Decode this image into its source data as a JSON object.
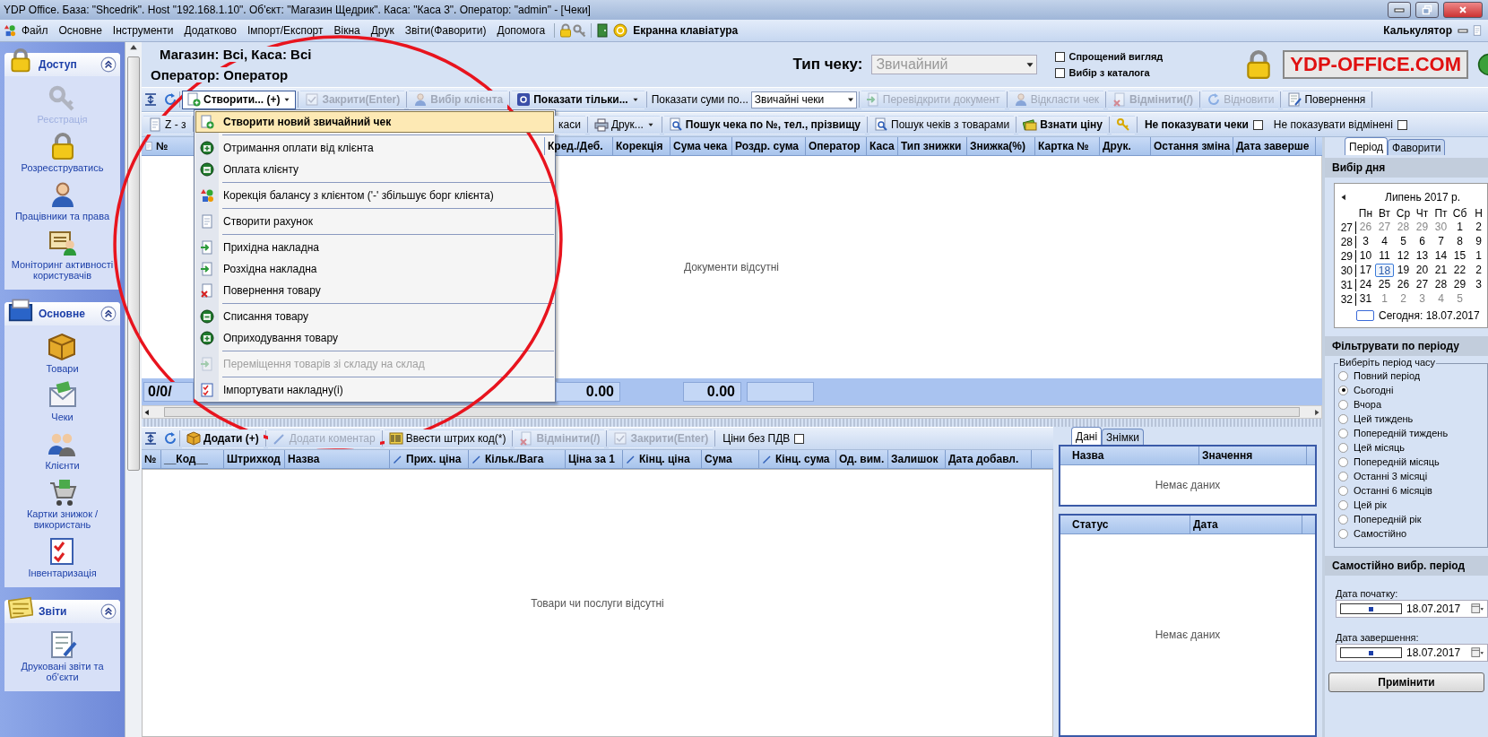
{
  "window": {
    "title": "YDP Office. База: \"Shcedrik\". Host \"192.168.1.10\". Об'єкт: \"Магазин Щедрик\". Каса: \"Каса 3\". Оператор: \"admin\" - [Чеки]"
  },
  "menu_bar": {
    "items": [
      "Файл",
      "Основне",
      "Інструменти",
      "Додатково",
      "Імпорт/Експорт",
      "Вікна",
      "Друк",
      "Звіти(Фаворити)",
      "Допомога"
    ],
    "keyboard": "Екранна клавіатура",
    "calculator": "Калькулятор"
  },
  "sidebar": {
    "groups": [
      {
        "title": "Доступ",
        "items": [
          {
            "label": "Реєстрація",
            "disabled": true
          },
          {
            "label": "Розреєструватись",
            "disabled": false
          },
          {
            "label": "Працівники та права",
            "disabled": false
          },
          {
            "label": "Моніторинг активності користувачів",
            "disabled": false
          }
        ]
      },
      {
        "title": "Основне",
        "items": [
          {
            "label": "Товари",
            "disabled": false
          },
          {
            "label": "Чеки",
            "disabled": false
          },
          {
            "label": "Клієнти",
            "disabled": false
          },
          {
            "label": "Картки знижок / використань",
            "disabled": false
          },
          {
            "label": "Інвентаризація",
            "disabled": false
          }
        ]
      },
      {
        "title": "Звіти",
        "items": [
          {
            "label": "Друковані звіти та об'єкти",
            "disabled": false
          }
        ]
      }
    ]
  },
  "header": {
    "store": "Магазин:  Всі, Каса: Всі",
    "operator": "Оператор:  Оператор",
    "check_type_label": "Тип чеку:",
    "check_type": {
      "value": "Звичайний",
      "disabled": true
    },
    "options": [
      {
        "label": "Спрощений вигляд",
        "checked": false
      },
      {
        "label": "Вибір з каталога",
        "checked": false
      }
    ],
    "logo": "YDP-OFFICE.COM"
  },
  "toolbar": {
    "items": [
      {
        "kind": "button",
        "label": "Створити... (+)",
        "bold": true,
        "disabled": false,
        "dropdown": true,
        "pressed": true
      },
      {
        "kind": "button",
        "label": "Закрити(Enter)",
        "bold": true,
        "disabled": true,
        "dropdown": false,
        "pressed": false
      },
      {
        "kind": "button",
        "label": "Вибір клієнта",
        "bold": true,
        "disabled": true,
        "dropdown": false,
        "pressed": false
      },
      {
        "kind": "button",
        "label": "Показати тільки...",
        "bold": true,
        "disabled": false,
        "dropdown": true,
        "pressed": false
      },
      {
        "kind": "label",
        "label": "Показати суми по..."
      },
      {
        "kind": "select",
        "label": "Звичайні чеки"
      },
      {
        "kind": "button",
        "label": "Перевідкрити документ",
        "bold": false,
        "disabled": true,
        "dropdown": false,
        "pressed": false
      },
      {
        "kind": "button",
        "label": "Відкласти чек",
        "bold": false,
        "disabled": true,
        "dropdown": false,
        "pressed": false
      },
      {
        "kind": "button",
        "label": "Відмінити(/)",
        "bold": true,
        "disabled": true,
        "dropdown": false,
        "pressed": false
      },
      {
        "kind": "button",
        "label": "Відновити",
        "bold": false,
        "disabled": true,
        "dropdown": false,
        "pressed": false
      },
      {
        "kind": "button",
        "label": "Повернення",
        "bold": false,
        "disabled": false,
        "dropdown": false,
        "pressed": false
      }
    ]
  },
  "toolbar2": {
    "left": [
      {
        "kind": "button",
        "label": "Z - з",
        "bold": false,
        "disabled": false,
        "dropdown": false
      }
    ],
    "right": [
      {
        "kind": "button",
        "label": "каси",
        "bold": false,
        "disabled": false,
        "dropdown": false
      },
      {
        "kind": "button",
        "label": "Друк...",
        "bold": false,
        "disabled": false,
        "dropdown": true
      },
      {
        "kind": "button",
        "label": "Пошук чека по №, тел., прізвищу",
        "bold": true,
        "disabled": false,
        "dropdown": false
      },
      {
        "kind": "button",
        "label": "Пошук чеків з товарами",
        "bold": false,
        "disabled": false,
        "dropdown": false
      },
      {
        "kind": "button",
        "label": "Взнати ціну",
        "bold": true,
        "disabled": false,
        "dropdown": false
      },
      {
        "kind": "icon"
      },
      {
        "kind": "checkbox",
        "label": "Не показувати чеки",
        "bold": true,
        "checked": false
      },
      {
        "kind": "checkbox",
        "label": "Не показувати відмінені",
        "bold": false,
        "checked": false
      }
    ]
  },
  "documents_table": {
    "first_column": "№",
    "columns": [
      "Кред./Деб.",
      "Корекція",
      "Сума чека",
      "Роздр. сума",
      "Оператор",
      "Каса",
      "Тип знижки",
      "Знижка(%)",
      "Картка №",
      "Друк.",
      "Остання зміна",
      "Дата заверше"
    ],
    "empty": "Документи відсутні",
    "totals_first": "0/0/",
    "totals": [
      "0.00",
      "0.00"
    ]
  },
  "create_menu": {
    "items": [
      {
        "kind": "item",
        "label": "Створити новий звичайний чек",
        "selected": true,
        "disabled": false
      },
      {
        "kind": "separator"
      },
      {
        "kind": "item",
        "label": "Отримання оплати від клієнта",
        "selected": false,
        "disabled": false
      },
      {
        "kind": "item",
        "label": "Оплата клієнту",
        "selected": false,
        "disabled": false
      },
      {
        "kind": "separator"
      },
      {
        "kind": "item",
        "label": "Корекція балансу з клієнтом ('-' збільшує борг клієнта)",
        "selected": false,
        "disabled": false
      },
      {
        "kind": "separator"
      },
      {
        "kind": "item",
        "label": "Створити рахунок",
        "selected": false,
        "disabled": false
      },
      {
        "kind": "separator"
      },
      {
        "kind": "item",
        "label": "Прихідна накладна",
        "selected": false,
        "disabled": false
      },
      {
        "kind": "item",
        "label": "Розхідна накладна",
        "selected": false,
        "disabled": false
      },
      {
        "kind": "item",
        "label": "Повернення товару",
        "selected": false,
        "disabled": false
      },
      {
        "kind": "separator"
      },
      {
        "kind": "item",
        "label": "Списання товару",
        "selected": false,
        "disabled": false
      },
      {
        "kind": "item",
        "label": "Оприходування товару",
        "selected": false,
        "disabled": false
      },
      {
        "kind": "separator"
      },
      {
        "kind": "item",
        "label": "Переміщення товарів зі складу на склад",
        "selected": false,
        "disabled": true
      },
      {
        "kind": "separator"
      },
      {
        "kind": "item",
        "label": "Імпортувати накладну(і)",
        "selected": false,
        "disabled": false
      }
    ]
  },
  "goods_toolbar": {
    "items": [
      {
        "kind": "button",
        "label": "Додати (+)",
        "bold": true,
        "disabled": false
      },
      {
        "kind": "button",
        "label": "Додати коментар",
        "bold": false,
        "disabled": true
      },
      {
        "kind": "button",
        "label": "Ввести штрих код(*)",
        "bold": false,
        "disabled": false
      },
      {
        "kind": "button",
        "label": "Відмінити(/)",
        "bold": true,
        "disabled": true
      },
      {
        "kind": "button",
        "label": "Закрити(Enter)",
        "bold": true,
        "disabled": true
      },
      {
        "kind": "checkbox",
        "label": "Ціни без ПДВ",
        "bold": false,
        "checked": false
      }
    ]
  },
  "goods_table": {
    "columns": [
      {
        "label": "№",
        "editable": false
      },
      {
        "label": "__Код__",
        "editable": false
      },
      {
        "label": "Штрихкод",
        "editable": false
      },
      {
        "label": "Назва",
        "editable": false
      },
      {
        "label": "Прих. ціна",
        "editable": true
      },
      {
        "label": "Кільк./Вага",
        "editable": true
      },
      {
        "label": "Ціна за 1",
        "editable": false
      },
      {
        "label": "Кінц. ціна",
        "editable": true
      },
      {
        "label": "Сума",
        "editable": false
      },
      {
        "label": "Кінц. сума",
        "editable": true
      },
      {
        "label": "Од. вим.",
        "editable": false
      },
      {
        "label": "Залишок",
        "editable": false
      },
      {
        "label": "Дата добавл.",
        "editable": false
      }
    ],
    "empty": "Товари чи послуги відсутні"
  },
  "details": {
    "tabs": [
      {
        "label": "Дані",
        "selected": true
      },
      {
        "label": "Знімки",
        "selected": false
      }
    ],
    "columns": [
      "Назва",
      "Значення"
    ],
    "empty": "Немає даних"
  },
  "status_grid": {
    "columns": [
      "Статус",
      "Дата"
    ],
    "empty": "Немає даних"
  },
  "period_panel": {
    "tabs": [
      {
        "label": "Період",
        "selected": true
      },
      {
        "label": "Фаворити",
        "selected": false
      }
    ],
    "day_title": "Вибір дня",
    "month": "Липень 2017 р.",
    "weekdays": [
      "Пн",
      "Вт",
      "Ср",
      "Чт",
      "Пт",
      "Сб",
      "Н"
    ],
    "weeks": [
      {
        "week": "27",
        "days": [
          {
            "d": "26",
            "other": true,
            "selected": false
          },
          {
            "d": "27",
            "other": true,
            "selected": false
          },
          {
            "d": "28",
            "other": true,
            "selected": false
          },
          {
            "d": "29",
            "other": true,
            "selected": false
          },
          {
            "d": "30",
            "other": true,
            "selected": false
          },
          {
            "d": "1",
            "other": false,
            "selected": false
          },
          {
            "d": "2",
            "other": false,
            "selected": false
          }
        ]
      },
      {
        "week": "28",
        "days": [
          {
            "d": "3",
            "other": false,
            "selected": false
          },
          {
            "d": "4",
            "other": false,
            "selected": false
          },
          {
            "d": "5",
            "other": false,
            "selected": false
          },
          {
            "d": "6",
            "other": false,
            "selected": false
          },
          {
            "d": "7",
            "other": false,
            "selected": false
          },
          {
            "d": "8",
            "other": false,
            "selected": false
          },
          {
            "d": "9",
            "other": false,
            "selected": false
          }
        ]
      },
      {
        "week": "29",
        "days": [
          {
            "d": "10",
            "other": false,
            "selected": false
          },
          {
            "d": "11",
            "other": false,
            "selected": false
          },
          {
            "d": "12",
            "other": false,
            "selected": false
          },
          {
            "d": "13",
            "other": false,
            "selected": false
          },
          {
            "d": "14",
            "other": false,
            "selected": false
          },
          {
            "d": "15",
            "other": false,
            "selected": false
          },
          {
            "d": "1",
            "other": false,
            "selected": false
          }
        ]
      },
      {
        "week": "30",
        "days": [
          {
            "d": "17",
            "other": false,
            "selected": false
          },
          {
            "d": "18",
            "other": false,
            "selected": true
          },
          {
            "d": "19",
            "other": false,
            "selected": false
          },
          {
            "d": "20",
            "other": false,
            "selected": false
          },
          {
            "d": "21",
            "other": false,
            "selected": false
          },
          {
            "d": "22",
            "other": false,
            "selected": false
          },
          {
            "d": "2",
            "other": false,
            "selected": false
          }
        ]
      },
      {
        "week": "31",
        "days": [
          {
            "d": "24",
            "other": false,
            "selected": false
          },
          {
            "d": "25",
            "other": false,
            "selected": false
          },
          {
            "d": "26",
            "other": false,
            "selected": false
          },
          {
            "d": "27",
            "other": false,
            "selected": false
          },
          {
            "d": "28",
            "other": false,
            "selected": false
          },
          {
            "d": "29",
            "other": false,
            "selected": false
          },
          {
            "d": "3",
            "other": false,
            "selected": false
          }
        ]
      },
      {
        "week": "32",
        "days": [
          {
            "d": "31",
            "other": false,
            "selected": false
          },
          {
            "d": "1",
            "other": true,
            "selected": false
          },
          {
            "d": "2",
            "other": true,
            "selected": false
          },
          {
            "d": "3",
            "other": true,
            "selected": false
          },
          {
            "d": "4",
            "other": true,
            "selected": false
          },
          {
            "d": "5",
            "other": true,
            "selected": false
          }
        ]
      }
    ],
    "today": "Сегодня: 18.07.2017",
    "filter_title": "Фільтрувати по періоду",
    "group_label": "Виберіть період часу",
    "periods": [
      {
        "label": "Повний період",
        "selected": false
      },
      {
        "label": "Сьогодні",
        "selected": true
      },
      {
        "label": "Вчора",
        "selected": false
      },
      {
        "label": "Цей тиждень",
        "selected": false
      },
      {
        "label": "Попередній тиждень",
        "selected": false
      },
      {
        "label": "Цей місяць",
        "selected": false
      },
      {
        "label": "Попередній місяць",
        "selected": false
      },
      {
        "label": "Останні 3 місяці",
        "selected": false
      },
      {
        "label": "Останні 6 місяців",
        "selected": false
      },
      {
        "label": "Цей рік",
        "selected": false
      },
      {
        "label": "Попередній рік",
        "selected": false
      },
      {
        "label": "Самостійно",
        "selected": false
      }
    ],
    "custom_title": "Самостійно вибр. період",
    "dates": [
      {
        "label": "Дата початку:",
        "checked": true,
        "value": "18.07.2017"
      },
      {
        "label": "Дата завершення:",
        "checked": true,
        "value": "18.07.2017"
      }
    ],
    "apply": "Примінити"
  }
}
